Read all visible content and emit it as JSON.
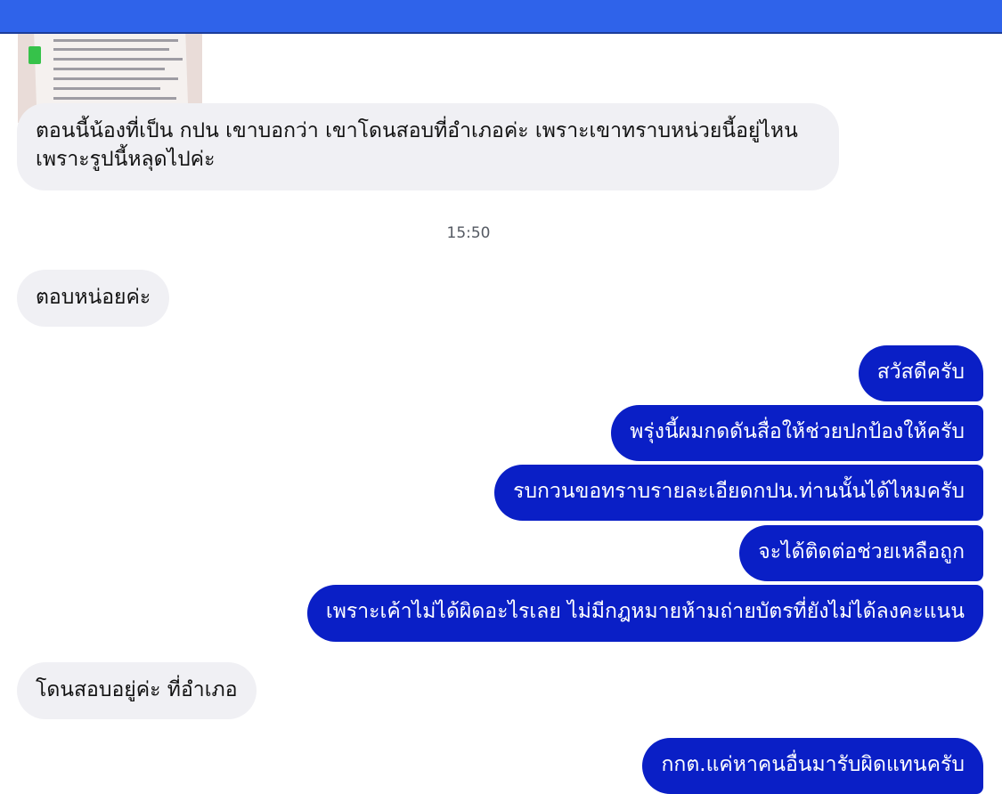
{
  "messages": {
    "m1": "ตอนนี้น้องที่เป็น กปน เขาบอกว่า เขาโดนสอบที่อำเภอค่ะ เพราะเขาทราบหน่วยนี้อยู่ไหน\nเพราะรูปนี้หลุดไปค่ะ",
    "timestamp": "15:50",
    "m2": "ตอบหน่อยค่ะ",
    "o1": "สวัสดีครับ",
    "o2": "พรุ่งนี้ผมกดดันสื่อให้ช่วยปกป้องให้ครับ",
    "o3": "รบกวนขอทราบรายละเอียดกปน.ท่านนั้นได้ไหมครับ",
    "o4": "จะได้ติดต่อช่วยเหลือถูก",
    "o5": "เพราะเค้าไม่ได้ผิดอะไรเลย ไม่มีกฎหมายห้ามถ่ายบัตรที่ยังไม่ได้ลงคะแนน",
    "m3": "โดนสอบอยู่ค่ะ ที่อำเภอ",
    "o6": "กกต.แค่หาคนอื่นมารับผิดแทนครับ"
  },
  "colors": {
    "header": "#2f63ea",
    "outgoing_bubble": "#0a1fc6",
    "incoming_bubble": "#f0f0f4"
  }
}
